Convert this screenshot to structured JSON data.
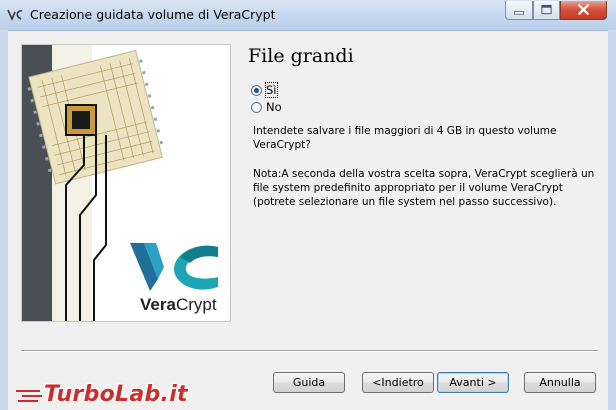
{
  "window": {
    "title": "Creazione guidata volume di VeraCrypt"
  },
  "logo": {
    "brand_prefix": "Vera",
    "brand_suffix": "Crypt",
    "accent_color": "#1fa6b4"
  },
  "page": {
    "title": "File grandi",
    "options": [
      {
        "label": "Sì",
        "checked": true
      },
      {
        "label": "No",
        "checked": false
      }
    ],
    "question": "Intendete salvare i file maggiori di 4 GB in questo volume VeraCrypt?",
    "note": "Nota:A seconda della vostra scelta sopra, VeraCrypt sceglierà un file system predefinito appropriato per il volume VeraCrypt (potrete selezionare un file system nel passo successivo)."
  },
  "buttons": {
    "help": "Guida",
    "back": "<Indietro",
    "next": "Avanti >",
    "cancel": "Annulla"
  },
  "watermark": {
    "text": "TurboLab.it"
  }
}
